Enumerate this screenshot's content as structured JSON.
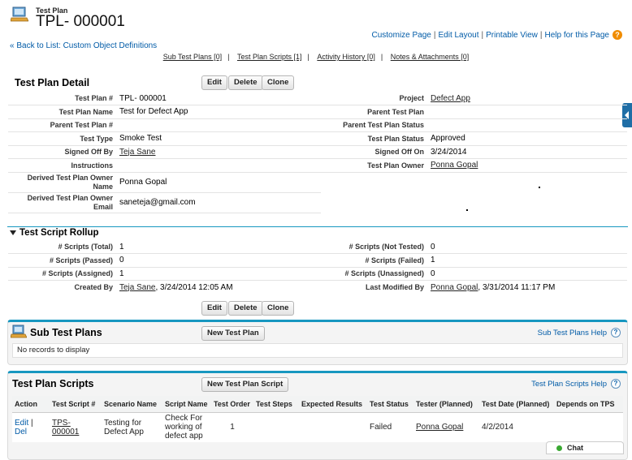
{
  "header": {
    "object_type": "Test Plan",
    "record_title": "TPL- 000001",
    "top_links": [
      "Customize Page",
      "Edit Layout",
      "Printable View",
      "Help for this Page"
    ],
    "back_link": "« Back to List: Custom Object Definitions",
    "related_links": [
      "Sub Test Plans [0]",
      "Test Plan Scripts [1]",
      "Activity History [0]",
      "Notes & Attachments [0]"
    ]
  },
  "detail": {
    "title": "Test Plan Detail",
    "buttons": [
      "Edit",
      "Delete",
      "Clone"
    ],
    "left_fields": [
      {
        "label": "Test Plan #",
        "value": "TPL- 000001"
      },
      {
        "label": "Test Plan Name",
        "value": "Test for Defect App"
      },
      {
        "label": "Parent Test Plan #",
        "value": ""
      },
      {
        "label": "Test Type",
        "value": "Smoke Test"
      },
      {
        "label": "Signed Off By",
        "value": "Teja Sane"
      },
      {
        "label": "Instructions",
        "value": ""
      },
      {
        "label": "Derived Test Plan Owner Name",
        "value": "Ponna Gopal"
      },
      {
        "label": "Derived Test Plan Owner Email",
        "value": "saneteja@gmail.com"
      }
    ],
    "right_fields": [
      {
        "label": "Project",
        "value": "Defect App"
      },
      {
        "label": "Parent Test Plan",
        "value": ""
      },
      {
        "label": "Parent Test Plan Status",
        "value": ""
      },
      {
        "label": "Test Plan Status",
        "value": "Approved"
      },
      {
        "label": "Signed Off On",
        "value": "3/24/2014"
      },
      {
        "label": "Test Plan Owner",
        "value": "Ponna Gopal"
      }
    ]
  },
  "rollup": {
    "title": "Test Script Rollup",
    "left_fields": [
      {
        "label": "# Scripts (Total)",
        "value": "1"
      },
      {
        "label": "# Scripts (Passed)",
        "value": "0"
      },
      {
        "label": "# Scripts (Assigned)",
        "value": "1"
      }
    ],
    "right_fields": [
      {
        "label": "# Scripts (Not Tested)",
        "value": "0"
      },
      {
        "label": "# Scripts (Failed)",
        "value": "1"
      },
      {
        "label": "# Scripts (Unassigned)",
        "value": "0"
      }
    ],
    "created_by": {
      "label": "Created By",
      "user": "Teja Sane",
      "stamp": ", 3/24/2014 12:05 AM"
    },
    "modified_by": {
      "label": "Last Modified By",
      "user": "Ponna Gopal",
      "stamp": ", 3/31/2014 11:17 PM"
    }
  },
  "sub_test_plans": {
    "title": "Sub Test Plans",
    "new_button": "New Test Plan",
    "help": "Sub Test Plans Help",
    "empty": "No records to display"
  },
  "scripts": {
    "title": "Test Plan Scripts",
    "new_button": "New Test Plan Script",
    "help": "Test Plan Scripts Help",
    "columns": [
      "Action",
      "Test Script #",
      "Scenario Name",
      "Script Name",
      "Test Order",
      "Test Steps",
      "Expected Results",
      "Test Status",
      "Tester (Planned)",
      "Test Date (Planned)",
      "Depends on TPS"
    ],
    "row": {
      "edit": "Edit",
      "sep": "|",
      "del": "Del",
      "script_no": "TPS- 000001",
      "scenario": "Testing for Defect App",
      "script_name": "Check For working of defect app",
      "order": "1",
      "steps": "",
      "expected": "",
      "status": "Failed",
      "tester": "Ponna Gopal",
      "date": "4/2/2014",
      "depends": ""
    }
  },
  "chat": {
    "label": "Chat"
  },
  "colors": {
    "accent": "#1797c0",
    "link": "#015ba7",
    "help": "#f08c00"
  }
}
